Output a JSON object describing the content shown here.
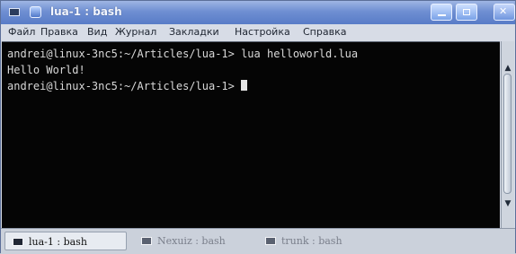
{
  "window": {
    "title": "lua-1 : bash"
  },
  "menu": [
    "Файл",
    "Правка",
    "Вид",
    "Журнал",
    "Закладки",
    "Настройка",
    "Справка"
  ],
  "terminal": {
    "lines": [
      "andrei@linux-3nc5:~/Articles/lua-1> lua helloworld.lua",
      "Hello World!",
      "andrei@linux-3nc5:~/Articles/lua-1> "
    ]
  },
  "tabs": [
    {
      "label": "lua-1 : bash",
      "active": true
    },
    {
      "label": "Nexuiz : bash",
      "active": false
    },
    {
      "label": "trunk : bash",
      "active": false
    }
  ],
  "icons": {
    "system_menu": "terminal-icon",
    "app": "konsole-icon",
    "minimize": "minimize-icon",
    "maximize": "maximize-icon",
    "close": "close-icon"
  },
  "colors": {
    "titlebar": "#6f8fd2",
    "terminal_bg": "#050505",
    "terminal_fg": "#d8d8d8"
  }
}
